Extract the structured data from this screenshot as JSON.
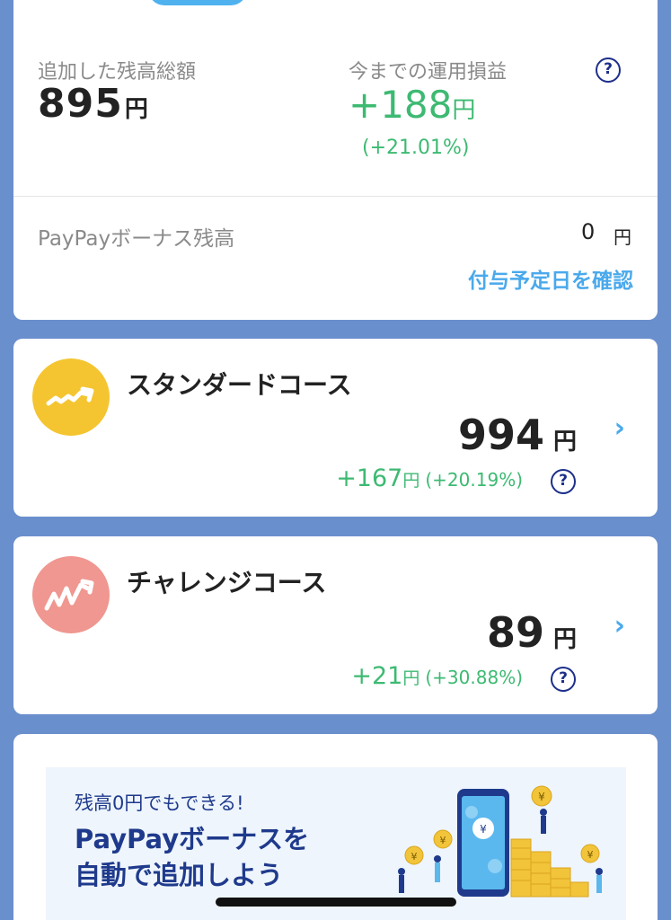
{
  "summary": {
    "added_balance_label": "追加した残高総額",
    "added_balance_value": "895",
    "added_balance_unit": "円",
    "profit_label": "今までの運用損益",
    "profit_value": "+188",
    "profit_unit": "円",
    "profit_pct": "(+21.01%)",
    "help_glyph": "?",
    "bonus_label": "PayPayボーナス残高",
    "bonus_value": "0",
    "bonus_unit": "円",
    "grant_date_link": "付与予定日を確認"
  },
  "courses": [
    {
      "title": "スタンダードコース",
      "amount": "994",
      "unit": "円",
      "gain": "+167",
      "gain_unit": "円",
      "gain_pct": "(+20.19%)",
      "icon": "trend-up-icon",
      "color": "#f4c531"
    },
    {
      "title": "チャレンジコース",
      "amount": "89",
      "unit": "円",
      "gain": "+21",
      "gain_unit": "円",
      "gain_pct": "(+30.88%)",
      "icon": "volatile-trend-icon",
      "color": "#ef9790"
    }
  ],
  "banner": {
    "subtitle": "残高0円でもできる!",
    "title_line1": "PayPayボーナスを",
    "title_line2": "自動で追加しよう"
  },
  "colors": {
    "background": "#6a8fcd",
    "accent_blue": "#4aa9ec",
    "gain_green": "#3dba72",
    "navy": "#1d2f8a"
  }
}
